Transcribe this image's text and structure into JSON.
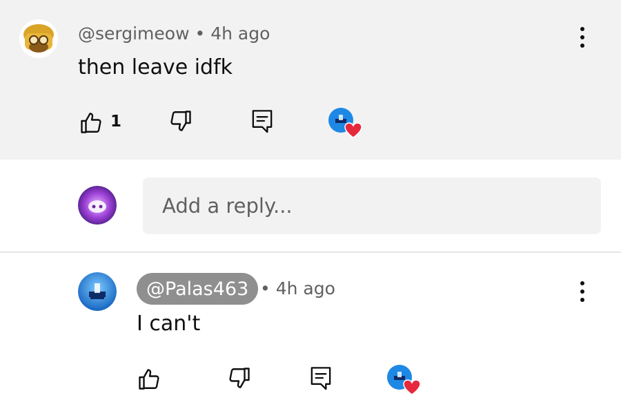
{
  "comment": {
    "handle": "@sergimeow",
    "time": "• 4h ago",
    "text": "then leave idfk",
    "like_count": "1"
  },
  "reply_box": {
    "placeholder": "Add a reply..."
  },
  "reply": {
    "handle": "@Palas463",
    "time": "• 4h ago",
    "text": "I can't"
  },
  "icons": [
    "thumbs-up-icon",
    "thumbs-down-icon",
    "reply-icon",
    "creator-heart-icon",
    "more-vert-icon"
  ],
  "colors": {
    "heart": "#e6283c",
    "highlight_pill": "#8f8f8f",
    "thread_bg": "#f2f2f2"
  }
}
